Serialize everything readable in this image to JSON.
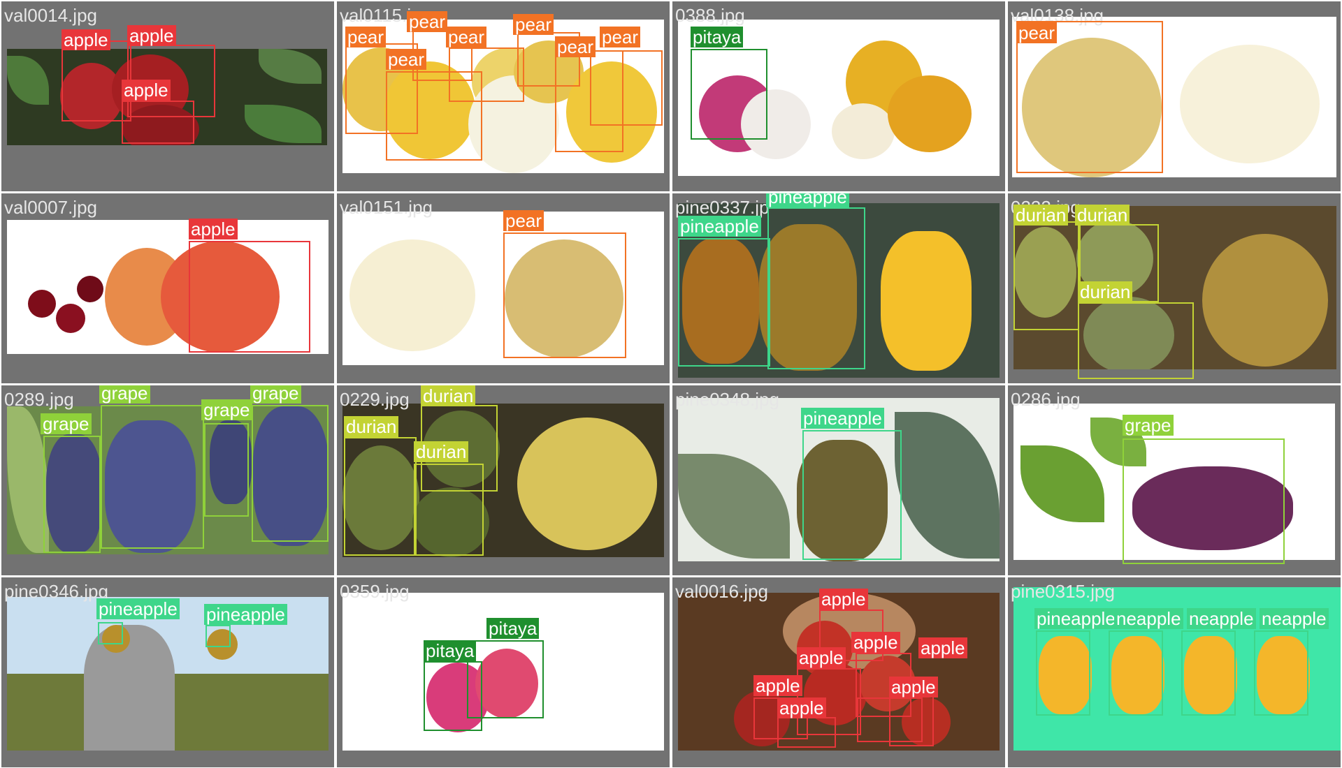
{
  "colors": {
    "apple": "#e8363a",
    "pear": "#f27224",
    "pitaya": "#1f8f2e",
    "pineapple": "#3ed68a",
    "durian": "#c3d334",
    "grape": "#8fd13a",
    "tile_bg": "#727272"
  },
  "tiles": [
    {
      "filename": "val0014.jpg",
      "labels": [
        "apple",
        "apple",
        "apple"
      ]
    },
    {
      "filename": "val0115.j",
      "labels": [
        "pear",
        "pear",
        "pear",
        "pear",
        "pear",
        "pear",
        "pear"
      ]
    },
    {
      "filename": "0388.jpg",
      "labels": [
        "pitaya"
      ]
    },
    {
      "filename": "val0138.jpg",
      "labels": [
        "pear"
      ]
    },
    {
      "filename": "val0007.jpg",
      "labels": [
        "apple"
      ]
    },
    {
      "filename": "val0151.jpg",
      "labels": [
        "pear"
      ]
    },
    {
      "filename": "pine0337.jp",
      "labels": [
        "pineapple",
        "pineapple"
      ]
    },
    {
      "filename": "0232.jpg",
      "labels": [
        "durian",
        "durian",
        "durian"
      ]
    },
    {
      "filename": "0289.jpg",
      "labels": [
        "grape",
        "grape",
        "grape",
        "grape"
      ]
    },
    {
      "filename": "0229.jpg",
      "labels": [
        "durian",
        "durian",
        "durian"
      ]
    },
    {
      "filename": "pine0348.jpg",
      "labels": [
        "pineapple"
      ]
    },
    {
      "filename": "0286.jpg",
      "labels": [
        "grape"
      ]
    },
    {
      "filename": "pine0346.jpg",
      "labels": [
        "pineapple",
        "pineapple"
      ]
    },
    {
      "filename": "0359.jpg",
      "labels": [
        "pitaya",
        "pitaya"
      ]
    },
    {
      "filename": "val0016.jpg",
      "labels": [
        "apple",
        "apple",
        "apple",
        "apple",
        "apple",
        "apple",
        "apple"
      ]
    },
    {
      "filename": "pine0315.jpg",
      "labels": [
        "pineapple",
        "neapple",
        "neapple",
        "neapple"
      ]
    }
  ]
}
